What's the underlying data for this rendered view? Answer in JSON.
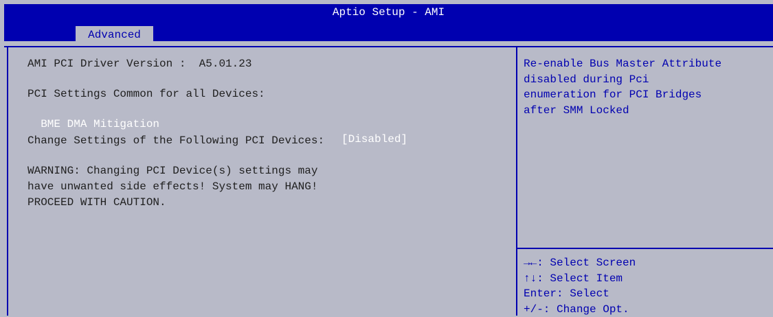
{
  "window": {
    "title": "Aptio Setup - AMI"
  },
  "tabs": [
    {
      "label": "Advanced",
      "active": true
    }
  ],
  "main": {
    "driver_version": "AMI PCI Driver Version :  A5.01.23",
    "common_heading": "PCI Settings Common for all Devices:",
    "setting": {
      "label": "BME DMA Mitigation",
      "value": "[Disabled]"
    },
    "change_heading": "Change Settings of the Following PCI Devices:",
    "warning": [
      "WARNING: Changing PCI Device(s) settings may",
      "have unwanted side effects! System may HANG!",
      "PROCEED WITH CAUTION."
    ]
  },
  "help": {
    "text": "Re-enable Bus Master Attribute\ndisabled during Pci\nenumeration for PCI Bridges\nafter SMM Locked"
  },
  "keys": [
    "→←: Select Screen",
    "↑↓: Select Item",
    "Enter: Select",
    "+/-: Change Opt."
  ],
  "colors": {
    "blue": "#0000b0",
    "panel": "#b8bac8",
    "text": "#202020",
    "highlight": "#ffffff"
  }
}
